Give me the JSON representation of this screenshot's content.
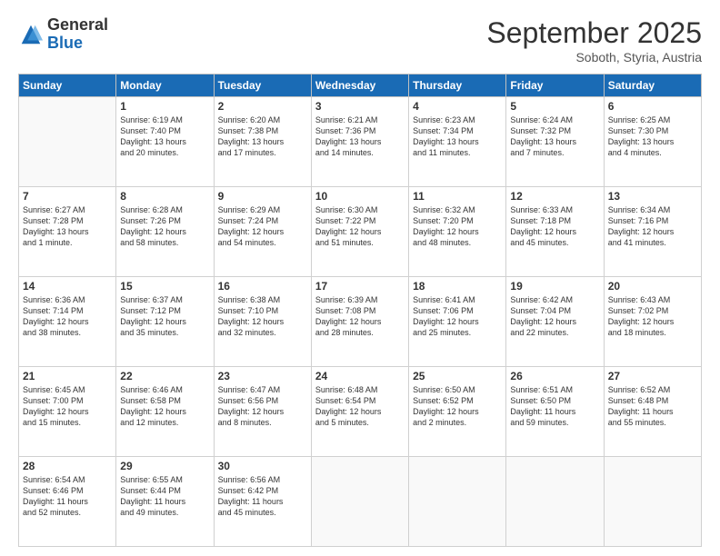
{
  "header": {
    "logo_line1": "General",
    "logo_line2": "Blue",
    "month_year": "September 2025",
    "location": "Soboth, Styria, Austria"
  },
  "weekdays": [
    "Sunday",
    "Monday",
    "Tuesday",
    "Wednesday",
    "Thursday",
    "Friday",
    "Saturday"
  ],
  "weeks": [
    [
      {
        "day": "",
        "info": ""
      },
      {
        "day": "1",
        "info": "Sunrise: 6:19 AM\nSunset: 7:40 PM\nDaylight: 13 hours\nand 20 minutes."
      },
      {
        "day": "2",
        "info": "Sunrise: 6:20 AM\nSunset: 7:38 PM\nDaylight: 13 hours\nand 17 minutes."
      },
      {
        "day": "3",
        "info": "Sunrise: 6:21 AM\nSunset: 7:36 PM\nDaylight: 13 hours\nand 14 minutes."
      },
      {
        "day": "4",
        "info": "Sunrise: 6:23 AM\nSunset: 7:34 PM\nDaylight: 13 hours\nand 11 minutes."
      },
      {
        "day": "5",
        "info": "Sunrise: 6:24 AM\nSunset: 7:32 PM\nDaylight: 13 hours\nand 7 minutes."
      },
      {
        "day": "6",
        "info": "Sunrise: 6:25 AM\nSunset: 7:30 PM\nDaylight: 13 hours\nand 4 minutes."
      }
    ],
    [
      {
        "day": "7",
        "info": "Sunrise: 6:27 AM\nSunset: 7:28 PM\nDaylight: 13 hours\nand 1 minute."
      },
      {
        "day": "8",
        "info": "Sunrise: 6:28 AM\nSunset: 7:26 PM\nDaylight: 12 hours\nand 58 minutes."
      },
      {
        "day": "9",
        "info": "Sunrise: 6:29 AM\nSunset: 7:24 PM\nDaylight: 12 hours\nand 54 minutes."
      },
      {
        "day": "10",
        "info": "Sunrise: 6:30 AM\nSunset: 7:22 PM\nDaylight: 12 hours\nand 51 minutes."
      },
      {
        "day": "11",
        "info": "Sunrise: 6:32 AM\nSunset: 7:20 PM\nDaylight: 12 hours\nand 48 minutes."
      },
      {
        "day": "12",
        "info": "Sunrise: 6:33 AM\nSunset: 7:18 PM\nDaylight: 12 hours\nand 45 minutes."
      },
      {
        "day": "13",
        "info": "Sunrise: 6:34 AM\nSunset: 7:16 PM\nDaylight: 12 hours\nand 41 minutes."
      }
    ],
    [
      {
        "day": "14",
        "info": "Sunrise: 6:36 AM\nSunset: 7:14 PM\nDaylight: 12 hours\nand 38 minutes."
      },
      {
        "day": "15",
        "info": "Sunrise: 6:37 AM\nSunset: 7:12 PM\nDaylight: 12 hours\nand 35 minutes."
      },
      {
        "day": "16",
        "info": "Sunrise: 6:38 AM\nSunset: 7:10 PM\nDaylight: 12 hours\nand 32 minutes."
      },
      {
        "day": "17",
        "info": "Sunrise: 6:39 AM\nSunset: 7:08 PM\nDaylight: 12 hours\nand 28 minutes."
      },
      {
        "day": "18",
        "info": "Sunrise: 6:41 AM\nSunset: 7:06 PM\nDaylight: 12 hours\nand 25 minutes."
      },
      {
        "day": "19",
        "info": "Sunrise: 6:42 AM\nSunset: 7:04 PM\nDaylight: 12 hours\nand 22 minutes."
      },
      {
        "day": "20",
        "info": "Sunrise: 6:43 AM\nSunset: 7:02 PM\nDaylight: 12 hours\nand 18 minutes."
      }
    ],
    [
      {
        "day": "21",
        "info": "Sunrise: 6:45 AM\nSunset: 7:00 PM\nDaylight: 12 hours\nand 15 minutes."
      },
      {
        "day": "22",
        "info": "Sunrise: 6:46 AM\nSunset: 6:58 PM\nDaylight: 12 hours\nand 12 minutes."
      },
      {
        "day": "23",
        "info": "Sunrise: 6:47 AM\nSunset: 6:56 PM\nDaylight: 12 hours\nand 8 minutes."
      },
      {
        "day": "24",
        "info": "Sunrise: 6:48 AM\nSunset: 6:54 PM\nDaylight: 12 hours\nand 5 minutes."
      },
      {
        "day": "25",
        "info": "Sunrise: 6:50 AM\nSunset: 6:52 PM\nDaylight: 12 hours\nand 2 minutes."
      },
      {
        "day": "26",
        "info": "Sunrise: 6:51 AM\nSunset: 6:50 PM\nDaylight: 11 hours\nand 59 minutes."
      },
      {
        "day": "27",
        "info": "Sunrise: 6:52 AM\nSunset: 6:48 PM\nDaylight: 11 hours\nand 55 minutes."
      }
    ],
    [
      {
        "day": "28",
        "info": "Sunrise: 6:54 AM\nSunset: 6:46 PM\nDaylight: 11 hours\nand 52 minutes."
      },
      {
        "day": "29",
        "info": "Sunrise: 6:55 AM\nSunset: 6:44 PM\nDaylight: 11 hours\nand 49 minutes."
      },
      {
        "day": "30",
        "info": "Sunrise: 6:56 AM\nSunset: 6:42 PM\nDaylight: 11 hours\nand 45 minutes."
      },
      {
        "day": "",
        "info": ""
      },
      {
        "day": "",
        "info": ""
      },
      {
        "day": "",
        "info": ""
      },
      {
        "day": "",
        "info": ""
      }
    ]
  ]
}
